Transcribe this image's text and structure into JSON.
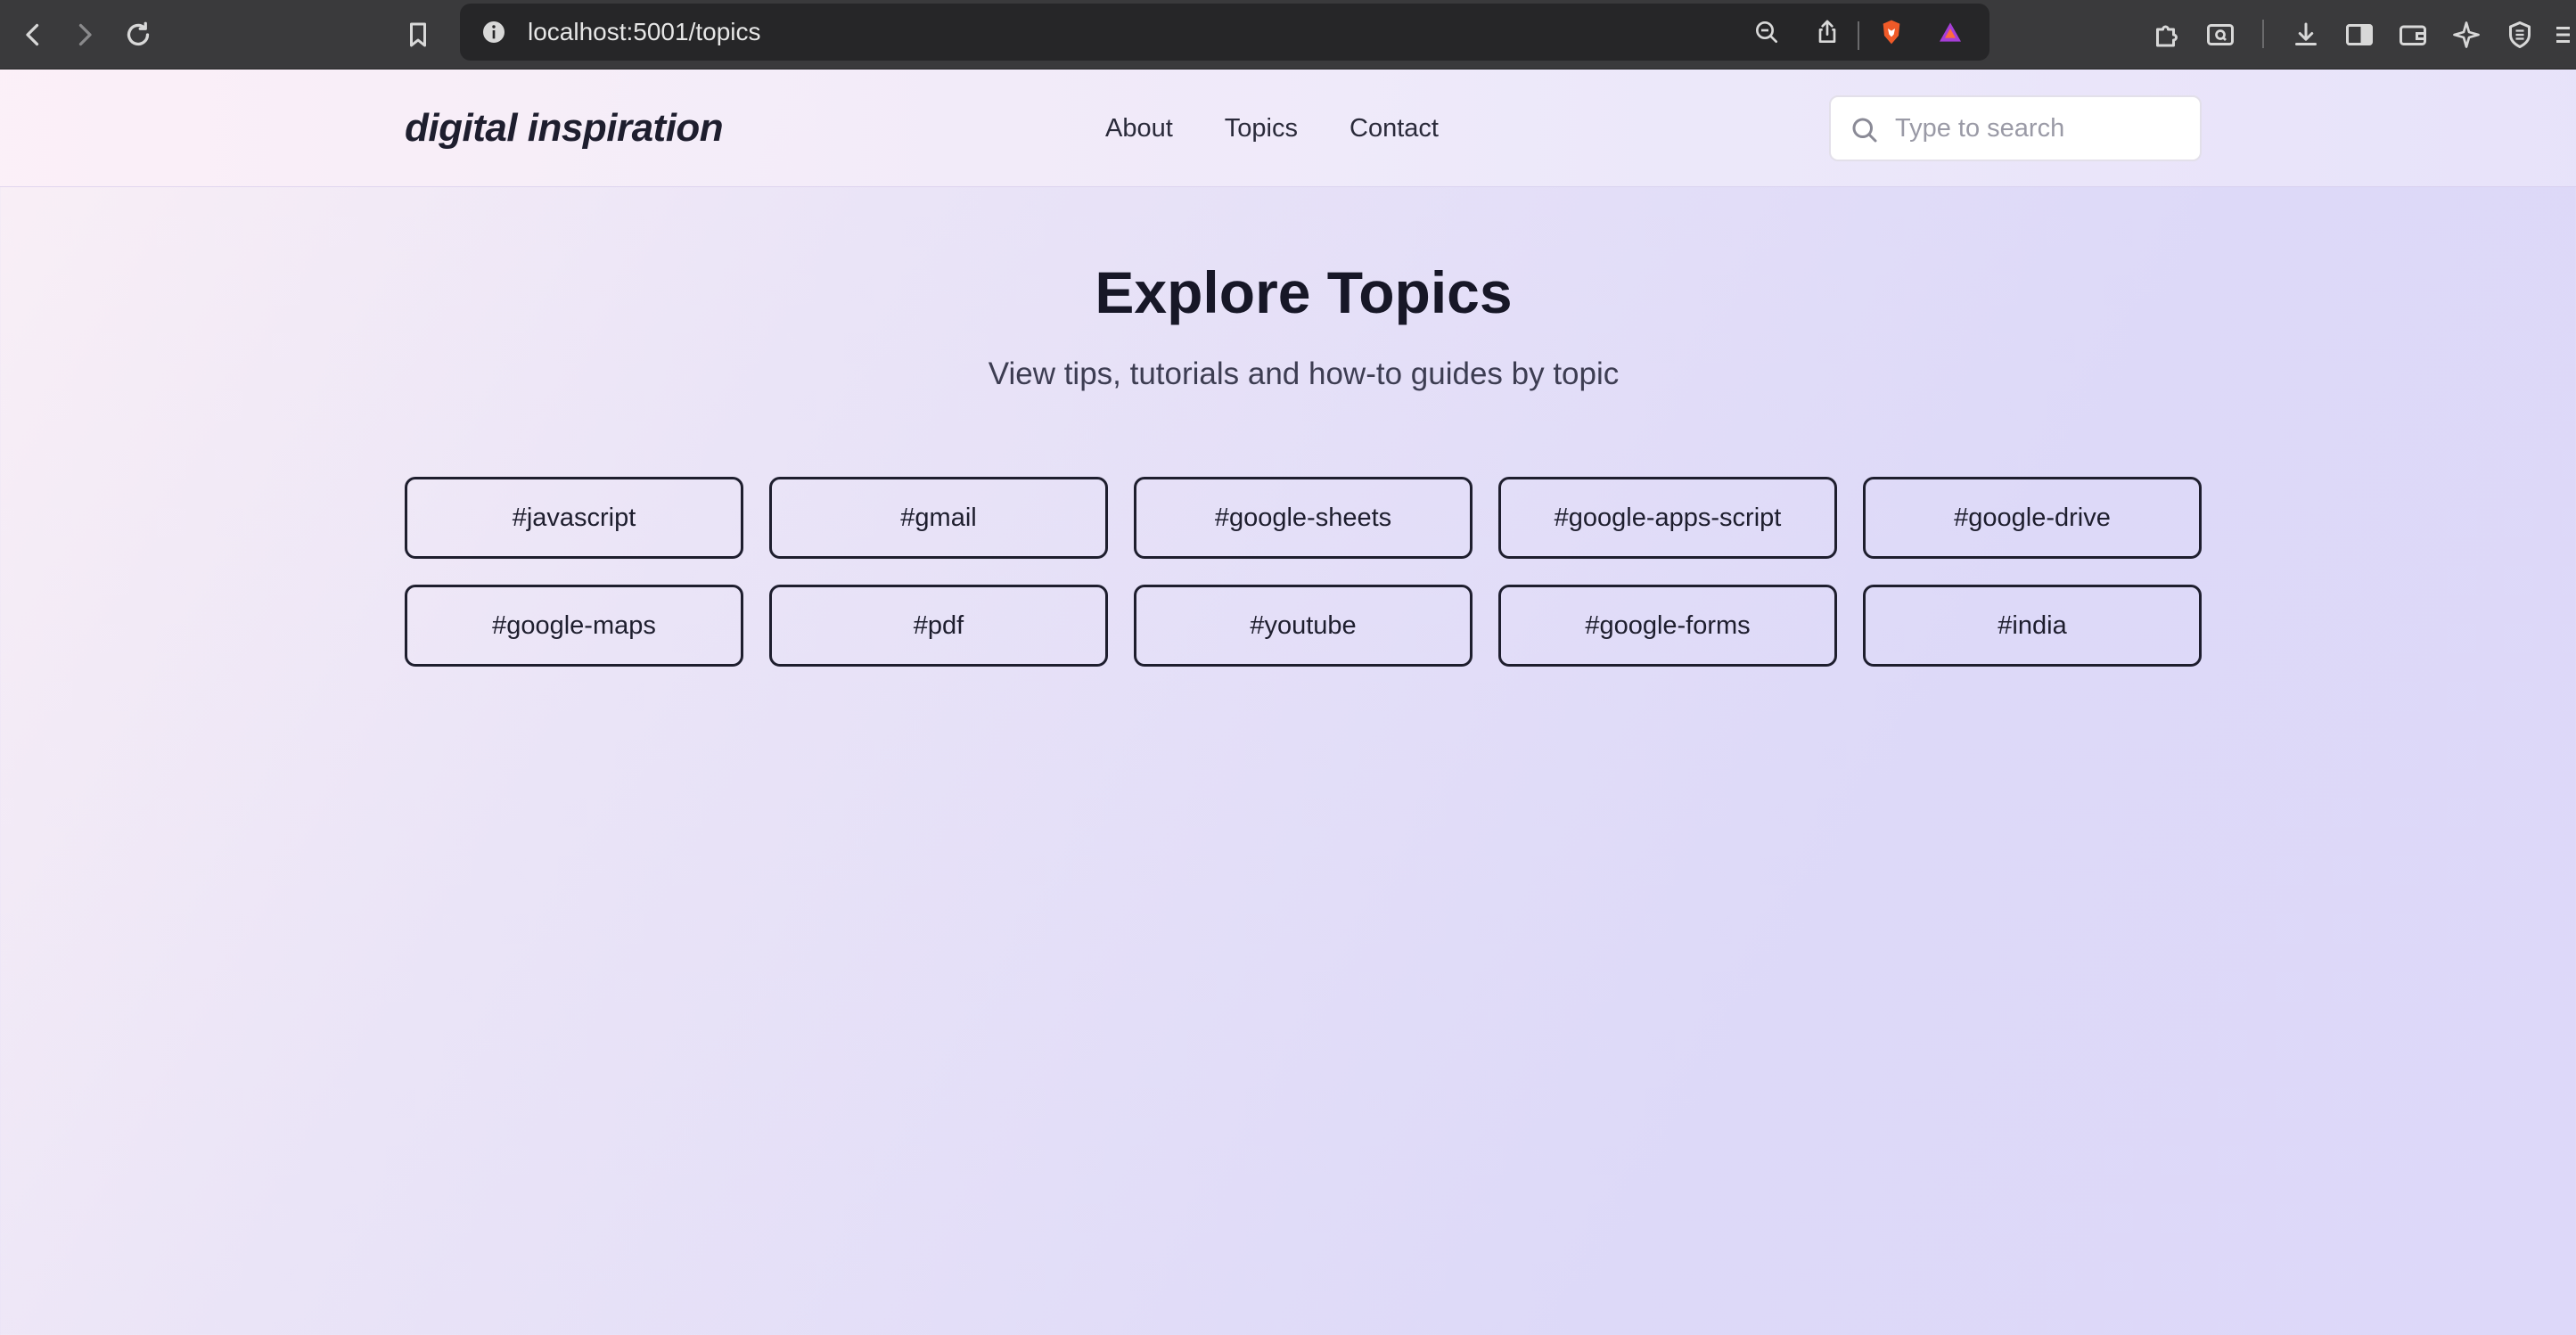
{
  "browser": {
    "url": "localhost:5001/topics"
  },
  "header": {
    "logo": "digital inspiration",
    "nav": [
      {
        "label": "About"
      },
      {
        "label": "Topics"
      },
      {
        "label": "Contact"
      }
    ],
    "search_placeholder": "Type to search"
  },
  "main": {
    "title": "Explore Topics",
    "subtitle": "View tips, tutorials and how-to guides by topic",
    "topics": [
      "#javascript",
      "#gmail",
      "#google-sheets",
      "#google-apps-script",
      "#google-drive",
      "#google-maps",
      "#pdf",
      "#youtube",
      "#google-forms",
      "#india"
    ]
  }
}
